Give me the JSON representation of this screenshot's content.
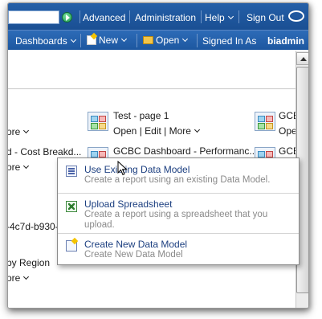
{
  "topbar": {
    "advanced": "Advanced",
    "administration": "Administration",
    "help": "Help",
    "sign_out": "Sign Out"
  },
  "navbar": {
    "dashboards": "Dashboards",
    "new": "New",
    "open": "Open",
    "signed_in_as": "Signed In As",
    "user": "biadmin"
  },
  "content": {
    "left_items": [
      {
        "text": "ore"
      },
      {
        "text": "d - Cost Breakd..."
      },
      {
        "text": "ore"
      },
      {
        "text": "-4c7d-b930-7"
      },
      {
        "text": "by Region"
      },
      {
        "text": "ore"
      }
    ],
    "items": [
      {
        "title": "Test - page 1",
        "links": "Open | Edit | More"
      },
      {
        "title": "GCBC Dashboard - Performanc..."
      }
    ],
    "right_items": [
      {
        "title": "GCB",
        "links": "Ope"
      },
      {
        "title": "GCB"
      }
    ]
  },
  "popup": {
    "items": [
      {
        "title": "Use Existing Data Model",
        "desc": "Create a report using an existing Data Model."
      },
      {
        "title": "Upload Spreadsheet",
        "desc": "Create a report using a spreadsheet that you upload."
      },
      {
        "title": "Create New Data Model",
        "desc": "Create New Data Model"
      }
    ]
  },
  "icons": {
    "search_go": "go-arrow-icon",
    "oracle": "oracle-logo-icon",
    "dashboard": "dashboard-icon",
    "data_model": "data-model-icon",
    "spreadsheet": "spreadsheet-icon",
    "new_data_model": "new-data-model-icon"
  },
  "colors": {
    "topbar": "#1f56a0",
    "link_blue": "#1c3f80",
    "desc_gray": "#8a8a8a"
  }
}
